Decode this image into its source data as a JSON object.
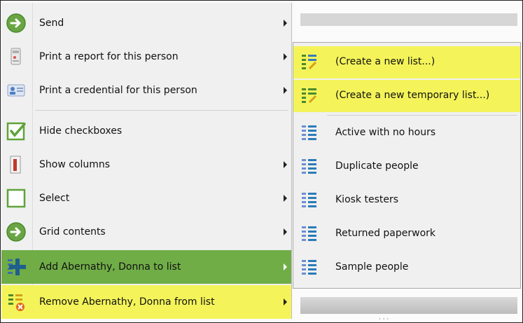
{
  "main_menu": {
    "items": [
      {
        "label": "Send",
        "icon": "arrow-circle-icon",
        "has_submenu": true
      },
      {
        "label": "Print a report for this person",
        "icon": "report-icon",
        "has_submenu": true
      },
      {
        "label": "Print a credential for this person",
        "icon": "credential-icon",
        "has_submenu": true
      },
      {
        "label": "Hide checkboxes",
        "icon": "checkbox-checked-icon",
        "has_submenu": false
      },
      {
        "label": "Show columns",
        "icon": "columns-icon",
        "has_submenu": true
      },
      {
        "label": "Select",
        "icon": "checkbox-empty-icon",
        "has_submenu": true
      },
      {
        "label": "Grid contents",
        "icon": "arrow-circle-icon",
        "has_submenu": true
      },
      {
        "label": "Add Abernathy, Donna to list",
        "icon": "add-to-list-icon",
        "has_submenu": true,
        "state": "hovered"
      },
      {
        "label": "Remove Abernathy, Donna from list",
        "icon": "remove-from-list-icon",
        "has_submenu": true,
        "state": "highlighted"
      }
    ]
  },
  "submenu": {
    "items": [
      {
        "label": "(Create a new list...)",
        "icon": "new-list-icon",
        "state": "highlighted"
      },
      {
        "label": "(Create a new temporary list...)",
        "icon": "new-temp-list-icon",
        "state": "highlighted"
      },
      {
        "label": "Active with no hours",
        "icon": "list-icon"
      },
      {
        "label": "Duplicate people",
        "icon": "list-icon"
      },
      {
        "label": "Kiosk testers",
        "icon": "list-icon"
      },
      {
        "label": "Returned paperwork",
        "icon": "list-icon"
      },
      {
        "label": "Sample people",
        "icon": "list-icon"
      }
    ]
  },
  "colors": {
    "hover_green": "#70ad47",
    "highlight_yellow": "#f4f45a",
    "menu_bg": "#f0f0f0"
  }
}
